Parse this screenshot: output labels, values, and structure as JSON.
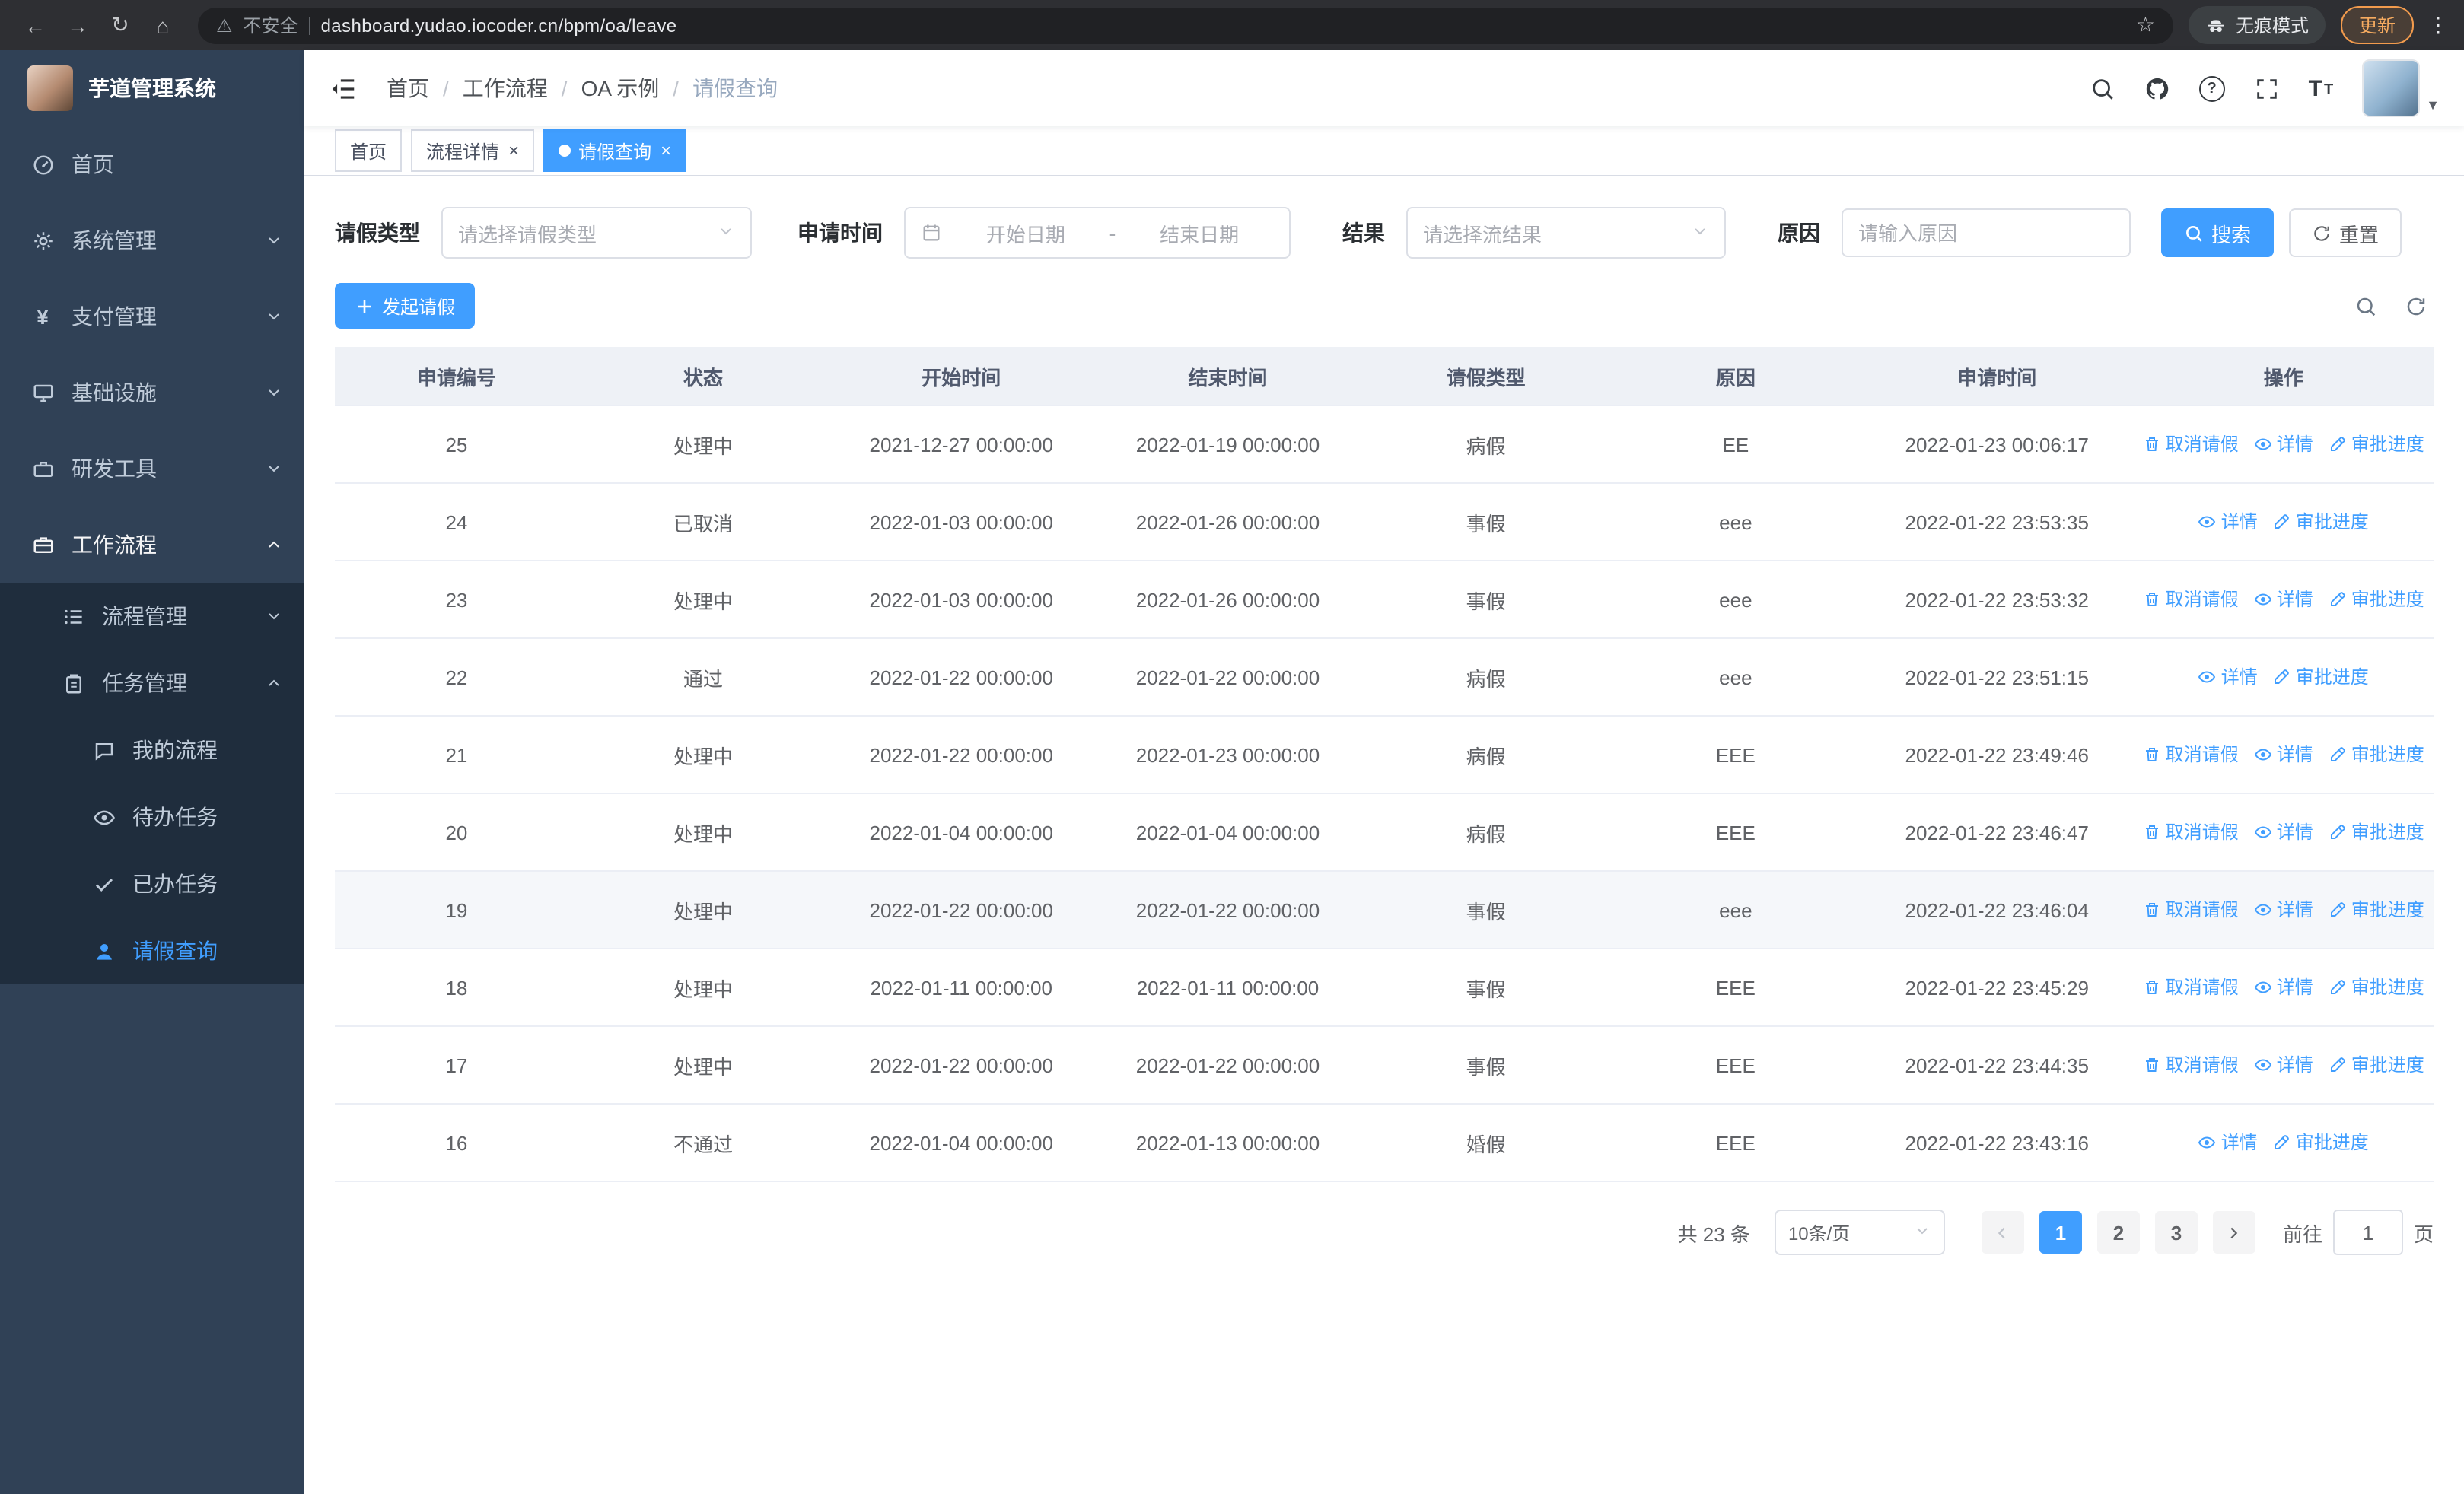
{
  "colors": {
    "accent": "#409eff",
    "sidebar_bg": "#304156",
    "sidebar_submenu_bg": "#1f2d3d",
    "sidebar_text": "#bfcbd9",
    "chrome_bg": "#2e2f33",
    "urlbar_bg": "#202124",
    "table_header_bg": "#eef1f6",
    "border": "#ebeef5"
  },
  "browser": {
    "security_warning": "不安全",
    "url": "dashboard.yudao.iocoder.cn/bpm/oa/leave",
    "incognito_label": "无痕模式",
    "update_label": "更新",
    "icons": [
      "back-icon",
      "forward-icon",
      "reload-icon",
      "home-icon",
      "warning-icon",
      "star-icon",
      "incognito-icon",
      "kebab-menu-icon"
    ]
  },
  "sidebar": {
    "app_title": "芋道管理系统",
    "items": [
      {
        "label": "首页",
        "icon": "dashboard-icon"
      },
      {
        "label": "系统管理",
        "icon": "gear-icon",
        "expandable": true
      },
      {
        "label": "支付管理",
        "icon": "yen-icon",
        "expandable": true
      },
      {
        "label": "基础设施",
        "icon": "monitor-icon",
        "expandable": true
      },
      {
        "label": "研发工具",
        "icon": "toolbox-icon",
        "expandable": true
      },
      {
        "label": "工作流程",
        "icon": "briefcase-icon",
        "expandable": true,
        "expanded": true
      }
    ],
    "submenu": [
      {
        "label": "流程管理",
        "icon": "process-list-icon",
        "expandable": true
      },
      {
        "label": "任务管理",
        "icon": "clipboard-icon",
        "expandable": true,
        "expanded": true
      }
    ],
    "children": [
      {
        "label": "我的流程",
        "icon": "chat-icon"
      },
      {
        "label": "待办任务",
        "icon": "eye-icon"
      },
      {
        "label": "已办任务",
        "icon": "check-icon"
      },
      {
        "label": "请假查询",
        "icon": "user-icon",
        "active": true
      }
    ]
  },
  "header": {
    "breadcrumb": [
      "首页",
      "工作流程",
      "OA 示例",
      "请假查询"
    ],
    "icons": [
      "search-icon",
      "github-icon",
      "help-icon",
      "fullscreen-icon",
      "font-size-icon",
      "avatar"
    ]
  },
  "tabs": [
    {
      "label": "首页",
      "closable": false,
      "active": false
    },
    {
      "label": "流程详情",
      "closable": true,
      "active": false
    },
    {
      "label": "请假查询",
      "closable": true,
      "active": true
    }
  ],
  "filters": {
    "leave_type_label": "请假类型",
    "leave_type_placeholder": "请选择请假类型",
    "apply_time_label": "申请时间",
    "start_date_placeholder": "开始日期",
    "range_separator": "-",
    "end_date_placeholder": "结束日期",
    "result_label": "结果",
    "result_placeholder": "请选择流结果",
    "reason_label": "原因",
    "reason_placeholder": "请输入原因",
    "search_label": "搜索",
    "reset_label": "重置"
  },
  "toolbar": {
    "create_label": "发起请假"
  },
  "table": {
    "columns": [
      "申请编号",
      "状态",
      "开始时间",
      "结束时间",
      "请假类型",
      "原因",
      "申请时间",
      "操作"
    ],
    "column_keys": [
      "id",
      "status",
      "start",
      "end",
      "type",
      "reason",
      "applied"
    ],
    "action_defs": {
      "cancel": {
        "label": "取消请假",
        "icon": "trash-icon"
      },
      "detail": {
        "label": "详情",
        "icon": "eye-icon"
      },
      "progress": {
        "label": "审批进度",
        "icon": "edit-icon"
      }
    },
    "rows": [
      {
        "id": "25",
        "status": "处理中",
        "start": "2021-12-27 00:00:00",
        "end": "2022-01-19 00:00:00",
        "type": "病假",
        "reason": "EE",
        "applied": "2022-01-23 00:06:17",
        "actions": [
          "cancel",
          "detail",
          "progress"
        ]
      },
      {
        "id": "24",
        "status": "已取消",
        "start": "2022-01-03 00:00:00",
        "end": "2022-01-26 00:00:00",
        "type": "事假",
        "reason": "eee",
        "applied": "2022-01-22 23:53:35",
        "actions": [
          "detail",
          "progress"
        ]
      },
      {
        "id": "23",
        "status": "处理中",
        "start": "2022-01-03 00:00:00",
        "end": "2022-01-26 00:00:00",
        "type": "事假",
        "reason": "eee",
        "applied": "2022-01-22 23:53:32",
        "actions": [
          "cancel",
          "detail",
          "progress"
        ]
      },
      {
        "id": "22",
        "status": "通过",
        "start": "2022-01-22 00:00:00",
        "end": "2022-01-22 00:00:00",
        "type": "病假",
        "reason": "eee",
        "applied": "2022-01-22 23:51:15",
        "actions": [
          "detail",
          "progress"
        ]
      },
      {
        "id": "21",
        "status": "处理中",
        "start": "2022-01-22 00:00:00",
        "end": "2022-01-23 00:00:00",
        "type": "病假",
        "reason": "EEE",
        "applied": "2022-01-22 23:49:46",
        "actions": [
          "cancel",
          "detail",
          "progress"
        ]
      },
      {
        "id": "20",
        "status": "处理中",
        "start": "2022-01-04 00:00:00",
        "end": "2022-01-04 00:00:00",
        "type": "病假",
        "reason": "EEE",
        "applied": "2022-01-22 23:46:47",
        "actions": [
          "cancel",
          "detail",
          "progress"
        ]
      },
      {
        "id": "19",
        "status": "处理中",
        "start": "2022-01-22 00:00:00",
        "end": "2022-01-22 00:00:00",
        "type": "事假",
        "reason": "eee",
        "applied": "2022-01-22 23:46:04",
        "actions": [
          "cancel",
          "detail",
          "progress"
        ],
        "highlight": true
      },
      {
        "id": "18",
        "status": "处理中",
        "start": "2022-01-11 00:00:00",
        "end": "2022-01-11 00:00:00",
        "type": "事假",
        "reason": "EEE",
        "applied": "2022-01-22 23:45:29",
        "actions": [
          "cancel",
          "detail",
          "progress"
        ]
      },
      {
        "id": "17",
        "status": "处理中",
        "start": "2022-01-22 00:00:00",
        "end": "2022-01-22 00:00:00",
        "type": "事假",
        "reason": "EEE",
        "applied": "2022-01-22 23:44:35",
        "actions": [
          "cancel",
          "detail",
          "progress"
        ]
      },
      {
        "id": "16",
        "status": "不通过",
        "start": "2022-01-04 00:00:00",
        "end": "2022-01-13 00:00:00",
        "type": "婚假",
        "reason": "EEE",
        "applied": "2022-01-22 23:43:16",
        "actions": [
          "detail",
          "progress"
        ]
      }
    ]
  },
  "pagination": {
    "total_text": "共 23 条",
    "page_size": "10条/页",
    "pages": [
      "1",
      "2",
      "3"
    ],
    "active_page": "1",
    "goto_label": "前往",
    "goto_value": "1",
    "page_unit": "页"
  }
}
